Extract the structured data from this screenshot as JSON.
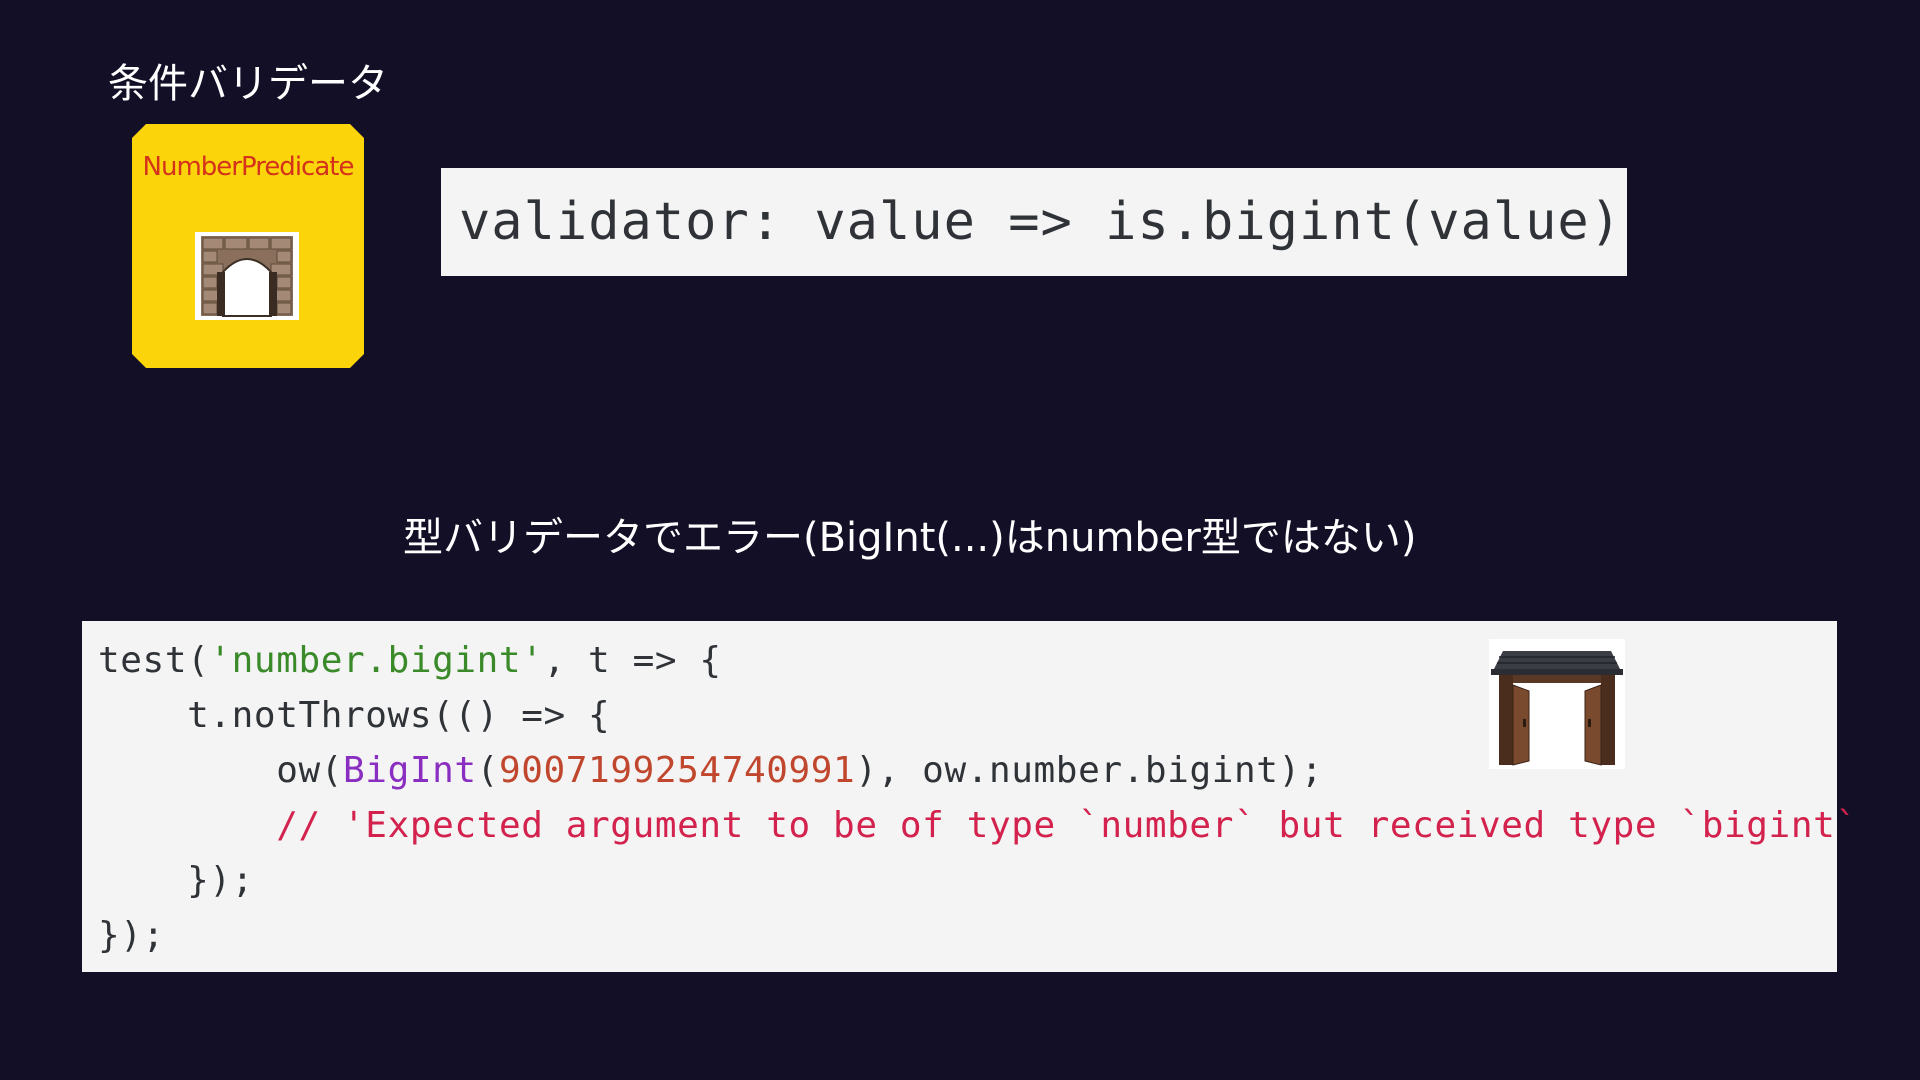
{
  "headings": {
    "condition_validator": "条件バリデータ",
    "type_error": "型バリデータでエラー(BigInt(...)はnumber型ではない)"
  },
  "predicate_card": {
    "label": "NumberPredicate",
    "icon": "stone-gate-icon",
    "background_color": "#fbd40a",
    "label_color": "#d4321b"
  },
  "validator_code": "validator: value => is.bigint(value)",
  "test_code": {
    "lines": [
      [
        {
          "t": "plain",
          "v": "test("
        },
        {
          "t": "str",
          "v": "'number.bigint'"
        },
        {
          "t": "plain",
          "v": ", t => {"
        }
      ],
      [
        {
          "t": "plain",
          "v": "    t.notThrows(() => {"
        }
      ],
      [
        {
          "t": "plain",
          "v": "        ow("
        },
        {
          "t": "fn",
          "v": "BigInt"
        },
        {
          "t": "plain",
          "v": "("
        },
        {
          "t": "num",
          "v": "9007199254740991"
        },
        {
          "t": "plain",
          "v": "), ow.number.bigint);"
        }
      ],
      [
        {
          "t": "plain",
          "v": "        "
        },
        {
          "t": "cmt",
          "v": "// 'Expected argument to be of type `number` but received type `bigint`"
        }
      ],
      [
        {
          "t": "plain",
          "v": "    });"
        }
      ],
      [
        {
          "t": "plain",
          "v": "});"
        }
      ]
    ],
    "icon": "wooden-gate-icon"
  },
  "colors": {
    "background": "#120f26",
    "code_background": "#f4f4f4",
    "string": "#3a8a2a",
    "function": "#8a2ec2",
    "number": "#c0462d",
    "comment": "#d2224d"
  }
}
